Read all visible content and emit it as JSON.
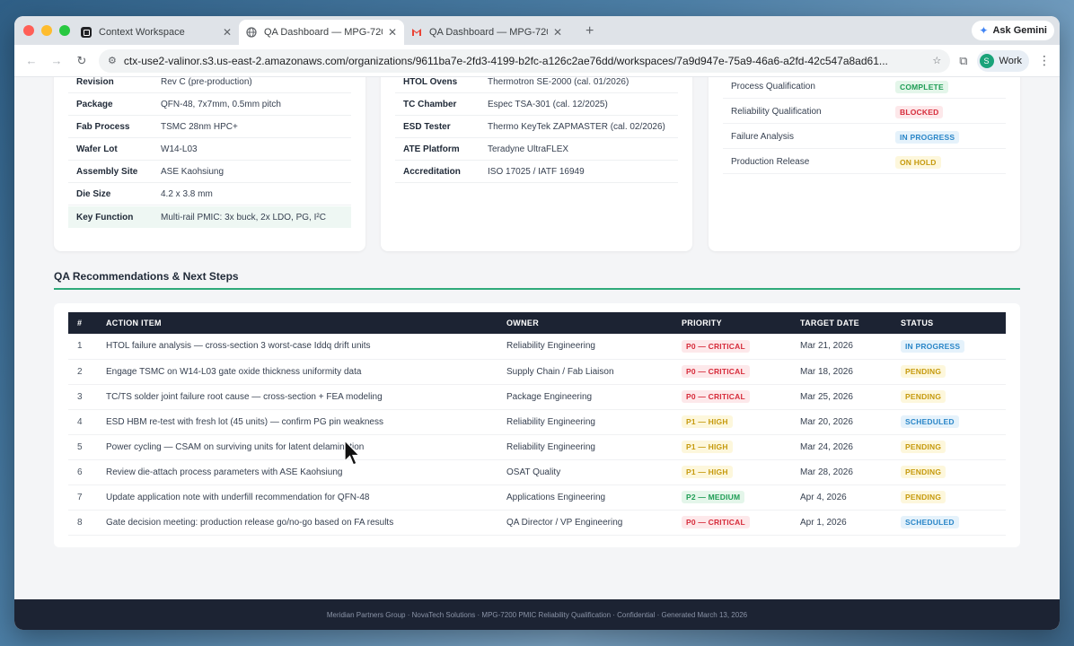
{
  "browser": {
    "tabs": [
      {
        "title": "Context Workspace",
        "active": false,
        "favicon": "context-icon"
      },
      {
        "title": "QA Dashboard — MPG-7200",
        "active": true,
        "favicon": "globe-icon"
      },
      {
        "title": "QA Dashboard — MPG-7200",
        "active": false,
        "favicon": "gmail-icon"
      }
    ],
    "ask_gemini": "Ask Gemini",
    "url": "ctx-use2-valinor.s3.us-east-2.amazonaws.com/organizations/9611ba7e-2fd3-4199-b2fc-a126c2ae76dd/workspaces/7a9d947e-75a9-46a6-a2fd-42c547a8ad61...",
    "profile": {
      "initial": "S",
      "label": "Work"
    }
  },
  "device": {
    "rows": [
      {
        "key": "Revision",
        "value": "Rev C (pre-production)"
      },
      {
        "key": "Package",
        "value": "QFN-48, 7x7mm, 0.5mm pitch"
      },
      {
        "key": "Fab Process",
        "value": "TSMC 28nm HPC+"
      },
      {
        "key": "Wafer Lot",
        "value": "W14-L03"
      },
      {
        "key": "Assembly Site",
        "value": "ASE Kaohsiung"
      },
      {
        "key": "Die Size",
        "value": "4.2 x 3.8 mm"
      },
      {
        "key": "Key Function",
        "value": "Multi-rail PMIC: 3x buck, 2x LDO, PG, I²C"
      }
    ]
  },
  "lab": {
    "rows": [
      {
        "key": "HTOL Ovens",
        "value": "Thermotron SE-2000 (cal. 01/2026)"
      },
      {
        "key": "TC Chamber",
        "value": "Espec TSA-301 (cal. 12/2025)"
      },
      {
        "key": "ESD Tester",
        "value": "Thermo KeyTek ZAPMASTER (cal. 02/2026)"
      },
      {
        "key": "ATE Platform",
        "value": "Teradyne UltraFLEX"
      },
      {
        "key": "Accreditation",
        "value": "ISO 17025 / IATF 16949"
      }
    ]
  },
  "milestones": {
    "rows": [
      {
        "key": "Process Qualification",
        "status": "COMPLETE",
        "style": "complete"
      },
      {
        "key": "Reliability Qualification",
        "status": "BLOCKED",
        "style": "blocked"
      },
      {
        "key": "Failure Analysis",
        "status": "IN PROGRESS",
        "style": "progress"
      },
      {
        "key": "Production Release",
        "status": "ON HOLD",
        "style": "hold"
      }
    ]
  },
  "recommendations": {
    "title": "QA Recommendations & Next Steps",
    "headers": [
      "#",
      "ACTION ITEM",
      "OWNER",
      "PRIORITY",
      "TARGET DATE",
      "STATUS"
    ],
    "rows": [
      {
        "n": "1",
        "action": "HTOL failure analysis — cross-section 3 worst-case Iddq drift units",
        "owner": "Reliability Engineering",
        "priority": "P0 — CRITICAL",
        "pstyle": "critical",
        "date": "Mar 21, 2026",
        "status": "IN PROGRESS",
        "sstyle": "progress"
      },
      {
        "n": "2",
        "action": "Engage TSMC on W14-L03 gate oxide thickness uniformity data",
        "owner": "Supply Chain / Fab Liaison",
        "priority": "P0 — CRITICAL",
        "pstyle": "critical",
        "date": "Mar 18, 2026",
        "status": "PENDING",
        "sstyle": "pending"
      },
      {
        "n": "3",
        "action": "TC/TS solder joint failure root cause — cross-section + FEA modeling",
        "owner": "Package Engineering",
        "priority": "P0 — CRITICAL",
        "pstyle": "critical",
        "date": "Mar 25, 2026",
        "status": "PENDING",
        "sstyle": "pending"
      },
      {
        "n": "4",
        "action": "ESD HBM re-test with fresh lot (45 units) — confirm PG pin weakness",
        "owner": "Reliability Engineering",
        "priority": "P1 — HIGH",
        "pstyle": "high",
        "date": "Mar 20, 2026",
        "status": "SCHEDULED",
        "sstyle": "scheduled"
      },
      {
        "n": "5",
        "action": "Power cycling — CSAM on surviving units for latent delamination",
        "owner": "Reliability Engineering",
        "priority": "P1 — HIGH",
        "pstyle": "high",
        "date": "Mar 24, 2026",
        "status": "PENDING",
        "sstyle": "pending"
      },
      {
        "n": "6",
        "action": "Review die-attach process parameters with ASE Kaohsiung",
        "owner": "OSAT Quality",
        "priority": "P1 — HIGH",
        "pstyle": "high",
        "date": "Mar 28, 2026",
        "status": "PENDING",
        "sstyle": "pending"
      },
      {
        "n": "7",
        "action": "Update application note with underfill recommendation for QFN-48",
        "owner": "Applications Engineering",
        "priority": "P2 — MEDIUM",
        "pstyle": "medium",
        "date": "Apr 4, 2026",
        "status": "PENDING",
        "sstyle": "pending"
      },
      {
        "n": "8",
        "action": "Gate decision meeting: production release go/no-go based on FA results",
        "owner": "QA Director / VP Engineering",
        "priority": "P0 — CRITICAL",
        "pstyle": "critical",
        "date": "Apr 1, 2026",
        "status": "SCHEDULED",
        "sstyle": "scheduled"
      }
    ]
  },
  "footer": "Meridian Partners Group · NovaTech Solutions · MPG-7200 PMIC Reliability Qualification · Confidential · Generated March 13, 2026"
}
